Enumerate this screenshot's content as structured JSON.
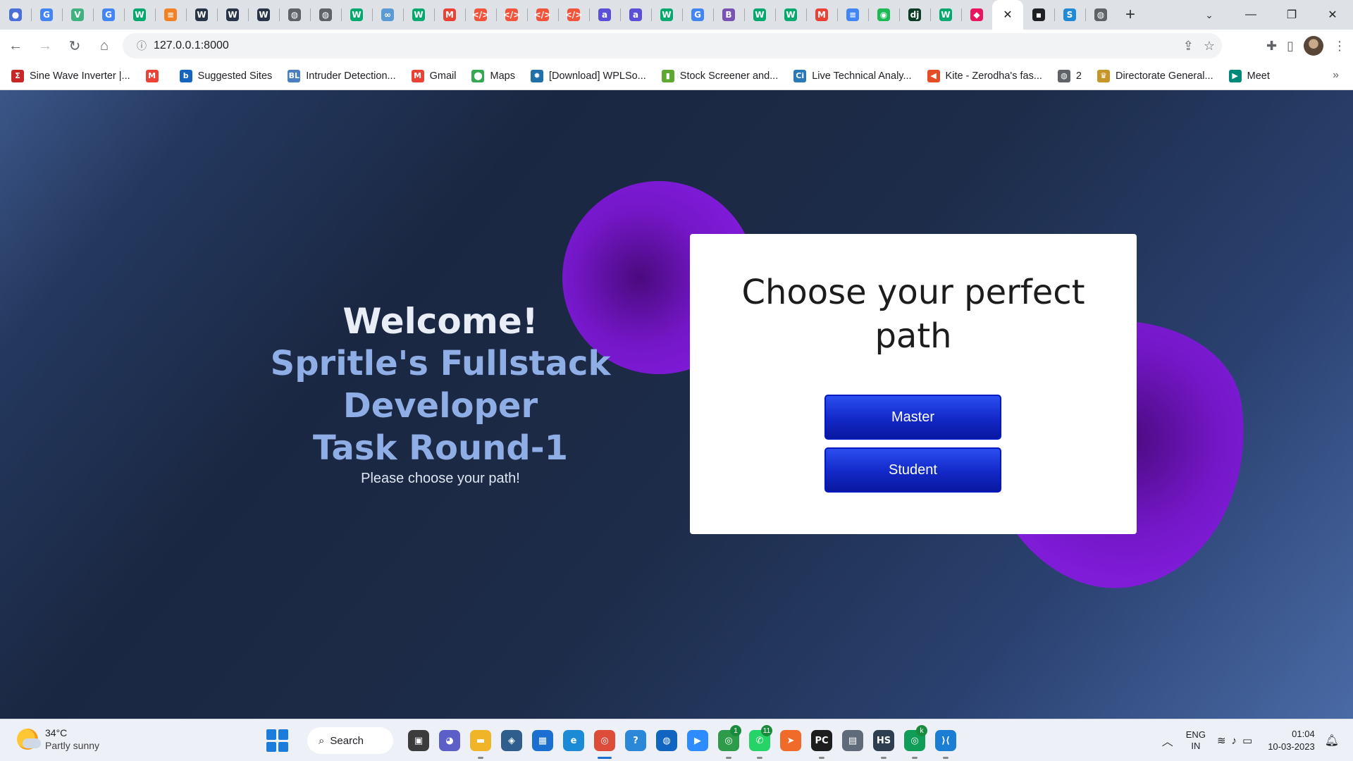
{
  "browser": {
    "tabs": [
      {
        "icon": "colored-circles-icon",
        "glyph": "●",
        "color": "#4a6fd8"
      },
      {
        "icon": "google-icon",
        "glyph": "G",
        "color": "#4285f4"
      },
      {
        "icon": "vue-icon",
        "glyph": "V",
        "color": "#3fb27f"
      },
      {
        "icon": "google-icon",
        "glyph": "G",
        "color": "#4285f4"
      },
      {
        "icon": "w3schools-icon",
        "glyph": "W",
        "color": "#04aa6d"
      },
      {
        "icon": "stackoverflow-icon",
        "glyph": "≡",
        "color": "#f48024"
      },
      {
        "icon": "webdev-icon",
        "glyph": "W",
        "color": "#283447"
      },
      {
        "icon": "webdev-icon",
        "glyph": "W",
        "color": "#283447"
      },
      {
        "icon": "webdev-icon",
        "glyph": "W",
        "color": "#283447"
      },
      {
        "icon": "globe-icon",
        "glyph": "◍",
        "color": "#5f6368"
      },
      {
        "icon": "globe-icon",
        "glyph": "◍",
        "color": "#5f6368"
      },
      {
        "icon": "w3schools-icon",
        "glyph": "W",
        "color": "#04aa6d"
      },
      {
        "icon": "cloud-icon",
        "glyph": "∞",
        "color": "#5b9bd5"
      },
      {
        "icon": "w3schools-icon",
        "glyph": "W",
        "color": "#04aa6d"
      },
      {
        "icon": "gmail-icon",
        "glyph": "M",
        "color": "#ea4335"
      },
      {
        "icon": "code-icon",
        "glyph": "</>",
        "color": "#f0553b"
      },
      {
        "icon": "code-icon",
        "glyph": "</>",
        "color": "#f0553b"
      },
      {
        "icon": "code-icon",
        "glyph": "</>",
        "color": "#f0553b"
      },
      {
        "icon": "code-icon",
        "glyph": "</>",
        "color": "#f0553b"
      },
      {
        "icon": "letter-a-icon",
        "glyph": "a",
        "color": "#5a4fd8"
      },
      {
        "icon": "letter-a-icon",
        "glyph": "a",
        "color": "#5a4fd8"
      },
      {
        "icon": "w3schools-icon",
        "glyph": "W",
        "color": "#04aa6d"
      },
      {
        "icon": "google-icon",
        "glyph": "G",
        "color": "#4285f4"
      },
      {
        "icon": "bootstrap-icon",
        "glyph": "B",
        "color": "#7952b3"
      },
      {
        "icon": "w3schools-icon",
        "glyph": "W",
        "color": "#04aa6d"
      },
      {
        "icon": "w3schools-icon",
        "glyph": "W",
        "color": "#04aa6d"
      },
      {
        "icon": "gmail-icon",
        "glyph": "M",
        "color": "#ea4335"
      },
      {
        "icon": "docs-icon",
        "glyph": "≡",
        "color": "#4285f4"
      },
      {
        "icon": "spotify-icon",
        "glyph": "◉",
        "color": "#1db954"
      },
      {
        "icon": "django-icon",
        "glyph": "dj",
        "color": "#0c3c26"
      },
      {
        "icon": "w3schools-icon",
        "glyph": "W",
        "color": "#04aa6d"
      },
      {
        "icon": "cube-icon",
        "glyph": "◆",
        "color": "#e8175d"
      },
      {
        "icon": "close-icon",
        "glyph": "✕",
        "color": "#ffffff",
        "active": true
      },
      {
        "icon": "dev-icon",
        "glyph": "▪",
        "color": "#202124"
      },
      {
        "icon": "bolt-icon",
        "glyph": "S",
        "color": "#1f8ad6"
      },
      {
        "icon": "globe-icon",
        "glyph": "◍",
        "color": "#5f6368"
      }
    ],
    "new_tab": "+",
    "tab_search": "⌄",
    "win": {
      "minimize": "—",
      "maximize": "❐",
      "close": "✕"
    },
    "url": "127.0.0.1:8000",
    "bookmarks": [
      {
        "icon": "sigma-icon",
        "glyph": "Σ",
        "color": "#c62828",
        "label": "Sine Wave Inverter |..."
      },
      {
        "icon": "gmail-icon",
        "glyph": "M",
        "color": "#ea4335",
        "label": ""
      },
      {
        "icon": "bing-icon",
        "glyph": "b",
        "color": "#1565c0",
        "label": "Suggested Sites"
      },
      {
        "icon": "bl-icon",
        "glyph": "BL",
        "color": "#4a7fc1",
        "label": "Intruder Detection..."
      },
      {
        "icon": "gmail-icon",
        "glyph": "M",
        "color": "#ea4335",
        "label": "Gmail"
      },
      {
        "icon": "maps-icon",
        "glyph": "⬤",
        "color": "#34a853",
        "label": "Maps"
      },
      {
        "icon": "gear-icon",
        "glyph": "✹",
        "color": "#1f6fa8",
        "label": "[Download] WPLSo..."
      },
      {
        "icon": "bar-chart-icon",
        "glyph": "▮",
        "color": "#5fa831",
        "label": "Stock Screener and..."
      },
      {
        "icon": "ci-icon",
        "glyph": "Ci",
        "color": "#2a7ab8",
        "label": "Live Technical Analy..."
      },
      {
        "icon": "kite-icon",
        "glyph": "◀",
        "color": "#e44d26",
        "label": "Kite - Zerodha's fas..."
      },
      {
        "icon": "globe-icon",
        "glyph": "◍",
        "color": "#5f6368",
        "label": "2"
      },
      {
        "icon": "emblem-icon",
        "glyph": "♛",
        "color": "#c7962a",
        "label": "Directorate General..."
      },
      {
        "icon": "meet-icon",
        "glyph": "▶",
        "color": "#00897b",
        "label": "Meet"
      }
    ],
    "bookmarks_more": "»"
  },
  "page": {
    "welcome": "Welcome!",
    "headline_line1": "Spritle's Fullstack Developer",
    "headline_line2": "Task Round-1",
    "subtitle": "Please choose your path!",
    "card_title": "Choose your perfect path",
    "buttons": {
      "master": "Master",
      "student": "Student"
    }
  },
  "taskbar": {
    "weather": {
      "temp": "34°C",
      "condition": "Partly sunny"
    },
    "search_label": "Search",
    "apps": [
      {
        "name": "task-view-icon",
        "glyph": "▣",
        "color": "#3c3c3c",
        "running": false
      },
      {
        "name": "teams-chat-icon",
        "glyph": "◕",
        "color": "#5b5fc7",
        "running": false
      },
      {
        "name": "file-explorer-icon",
        "glyph": "▬",
        "color": "#f0b429",
        "running": true
      },
      {
        "name": "sql-icon",
        "glyph": "◈",
        "color": "#2f5e8c",
        "running": false
      },
      {
        "name": "store-icon",
        "glyph": "▦",
        "color": "#1a6fd1",
        "running": false
      },
      {
        "name": "edge-icon",
        "glyph": "e",
        "color": "#1c8bd6",
        "running": false
      },
      {
        "name": "chrome-icon",
        "glyph": "◎",
        "color": "#dd4b39",
        "running": true,
        "active": true
      },
      {
        "name": "help-icon",
        "glyph": "?",
        "color": "#2b88d8",
        "running": false
      },
      {
        "name": "remote-icon",
        "glyph": "◍",
        "color": "#1065c0",
        "running": false
      },
      {
        "name": "zoom-icon",
        "glyph": "▶",
        "color": "#2d8cff",
        "running": false
      },
      {
        "name": "chrome-profile-icon",
        "glyph": "◎",
        "color": "#2e9b4a",
        "running": true,
        "badge": "1"
      },
      {
        "name": "whatsapp-icon",
        "glyph": "✆",
        "color": "#25d366",
        "running": true,
        "badge": "11"
      },
      {
        "name": "compass-icon",
        "glyph": "➤",
        "color": "#f06a2a",
        "running": false
      },
      {
        "name": "pycharm-icon",
        "glyph": "PC",
        "color": "#1d1d1d",
        "running": true
      },
      {
        "name": "calculator-icon",
        "glyph": "▤",
        "color": "#5f6b7a",
        "running": false
      },
      {
        "name": "hs-icon",
        "glyph": "HS",
        "color": "#2c3e50",
        "running": true
      },
      {
        "name": "chrome-k-icon",
        "glyph": "◎",
        "color": "#0f9d58",
        "running": true,
        "badge": "k"
      },
      {
        "name": "vscode-icon",
        "glyph": "⟩⟨",
        "color": "#1a7fd4",
        "running": true
      }
    ],
    "lang_1": "ENG",
    "lang_2": "IN",
    "time": "01:04",
    "date": "10-03-2023"
  }
}
